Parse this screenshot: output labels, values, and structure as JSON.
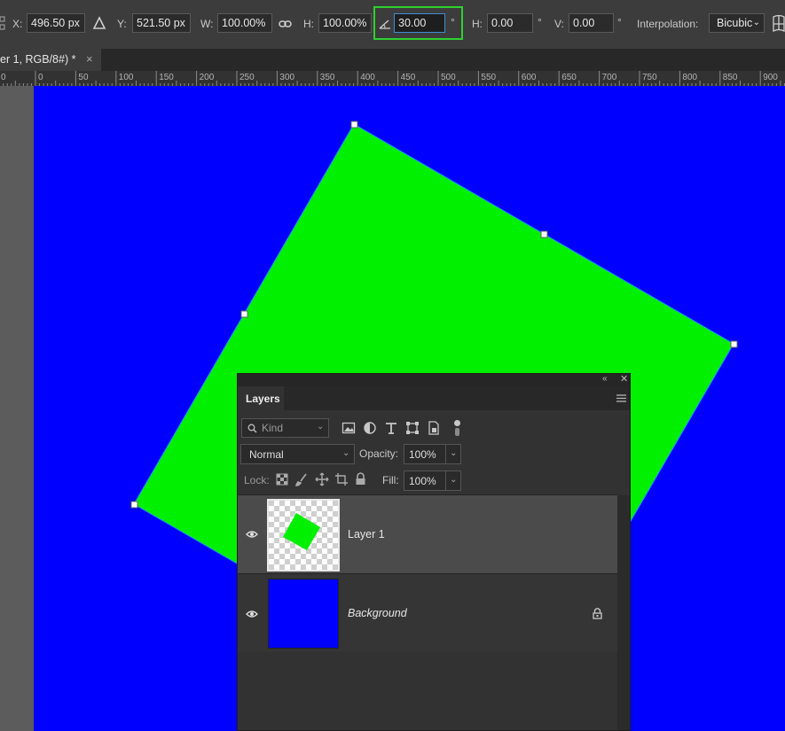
{
  "options_bar": {
    "x_label": "X:",
    "x_value": "496.50 px",
    "y_label": "Y:",
    "y_value": "521.50 px",
    "w_label": "W:",
    "w_value": "100.00%",
    "h_label": "H:",
    "h_value": "100.00%",
    "angle_value": "30.00",
    "degree_symbol": "°",
    "skew_h_label": "H:",
    "skew_h_value": "0.00",
    "skew_v_label": "V:",
    "skew_v_value": "0.00",
    "interpolation_label": "Interpolation:",
    "interpolation_value": "Bicubic"
  },
  "document_tab": {
    "title": "er 1, RGB/8#) *",
    "close": "×"
  },
  "ruler": {
    "labels": [
      "0",
      "0",
      "50",
      "100",
      "150",
      "200",
      "250",
      "300",
      "350",
      "400",
      "450",
      "500",
      "550",
      "600",
      "650",
      "700",
      "750",
      "800",
      "850",
      "900"
    ]
  },
  "colors": {
    "canvas_background": "#0000fe",
    "shape_fill": "#00f000",
    "highlight": "#2fd12f"
  },
  "layers_panel": {
    "tab_label": "Layers",
    "filter_kind": "Kind",
    "blend_mode": "Normal",
    "opacity_label": "Opacity:",
    "opacity_value": "100%",
    "lock_label": "Lock:",
    "fill_label": "Fill:",
    "fill_value": "100%",
    "layers": [
      {
        "name": "Layer 1",
        "selected": true,
        "visible": true
      },
      {
        "name": "Background",
        "selected": false,
        "visible": true,
        "locked": true
      }
    ]
  }
}
